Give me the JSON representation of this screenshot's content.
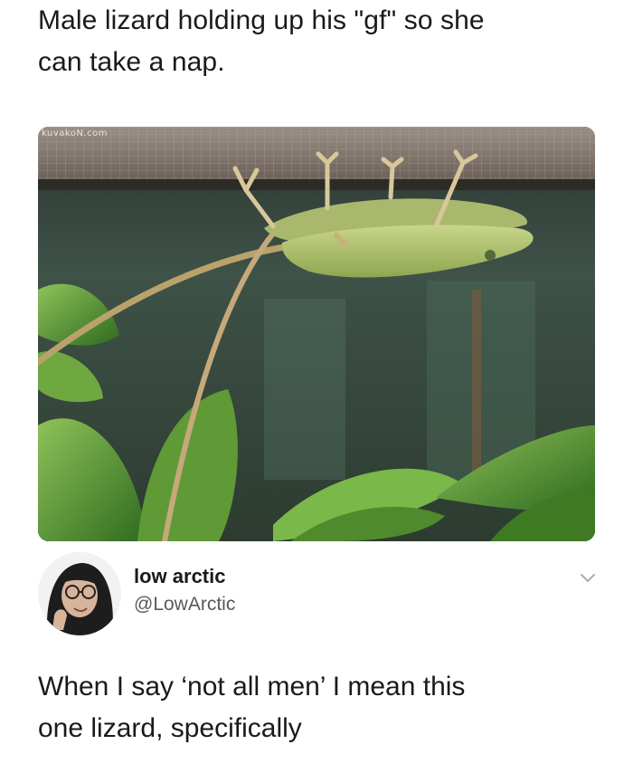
{
  "caption": {
    "line1": "Male lizard holding up his \"gf\" so she",
    "line2": "can take a nap."
  },
  "photo": {
    "watermark": "kuvakoN.com",
    "subject": "lizards-image"
  },
  "author": {
    "name": "low arctic",
    "handle": "@LowArctic",
    "menu_icon": "chevron-down-icon"
  },
  "tweet": {
    "line1": "When I say ‘not all men’ I mean this",
    "line2": "one lizard, specifically"
  },
  "colors": {
    "text": "#1a1a1a",
    "handle": "#555a60",
    "chevron": "#a8adb2"
  }
}
